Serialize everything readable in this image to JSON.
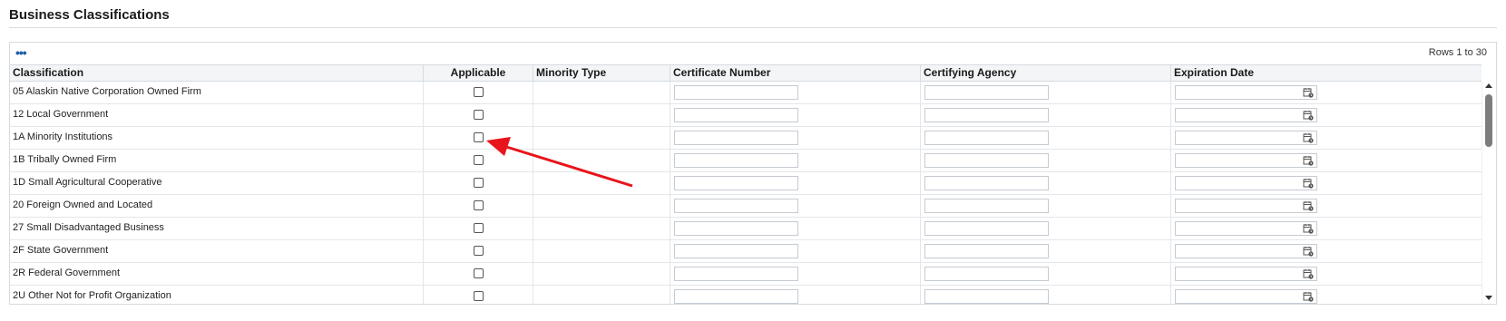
{
  "page": {
    "title": "Business Classifications"
  },
  "table": {
    "rows_info": "Rows 1 to 30",
    "more_icon": "more-actions-icon",
    "columns": [
      "Classification",
      "Applicable",
      "Minority Type",
      "Certificate Number",
      "Certifying Agency",
      "Expiration Date"
    ],
    "rows": [
      {
        "classification": "05 Alaskin Native Corporation Owned Firm",
        "applicable": false,
        "minority_type": "",
        "certificate_number": "",
        "certifying_agency": "",
        "expiration_date": ""
      },
      {
        "classification": "12 Local Government",
        "applicable": false,
        "minority_type": "",
        "certificate_number": "",
        "certifying_agency": "",
        "expiration_date": ""
      },
      {
        "classification": "1A Minority Institutions",
        "applicable": false,
        "minority_type": "",
        "certificate_number": "",
        "certifying_agency": "",
        "expiration_date": ""
      },
      {
        "classification": "1B Tribally Owned Firm",
        "applicable": false,
        "minority_type": "",
        "certificate_number": "",
        "certifying_agency": "",
        "expiration_date": ""
      },
      {
        "classification": "1D Small Agricultural Cooperative",
        "applicable": false,
        "minority_type": "",
        "certificate_number": "",
        "certifying_agency": "",
        "expiration_date": ""
      },
      {
        "classification": "20 Foreign Owned and Located",
        "applicable": false,
        "minority_type": "",
        "certificate_number": "",
        "certifying_agency": "",
        "expiration_date": ""
      },
      {
        "classification": "27 Small Disadvantaged Business",
        "applicable": false,
        "minority_type": "",
        "certificate_number": "",
        "certifying_agency": "",
        "expiration_date": ""
      },
      {
        "classification": "2F State Government",
        "applicable": false,
        "minority_type": "",
        "certificate_number": "",
        "certifying_agency": "",
        "expiration_date": ""
      },
      {
        "classification": "2R Federal Government",
        "applicable": false,
        "minority_type": "",
        "certificate_number": "",
        "certifying_agency": "",
        "expiration_date": ""
      },
      {
        "classification": "2U Other Not for Profit Organization",
        "applicable": false,
        "minority_type": "",
        "certificate_number": "",
        "certifying_agency": "",
        "expiration_date": ""
      }
    ],
    "calendar_icon": "calendar-icon"
  },
  "annotation": {
    "color": "#e8141b"
  }
}
